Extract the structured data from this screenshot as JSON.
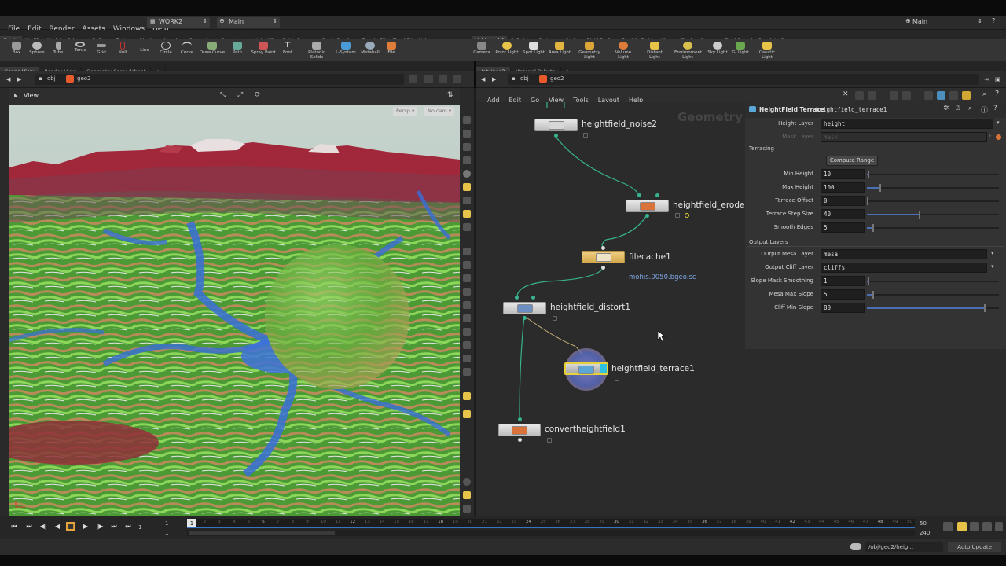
{
  "menubar": {
    "items": [
      "File",
      "Edit",
      "Render",
      "Assets",
      "Windows",
      "Help"
    ],
    "desktop": "WORK2",
    "context": "Main",
    "right_context": "Main"
  },
  "shelf_left": {
    "tabs": [
      "Create",
      "Modify",
      "Model",
      "Polygon",
      "Deform",
      "Texture",
      "Rigging",
      "Muscles",
      "Characters",
      "Constraints",
      "Hair Utils",
      "Guide Process",
      "Guide Brushes",
      "Terrain FX",
      "Cloud FX",
      "Volume"
    ],
    "tools": [
      "Box",
      "Sphere",
      "Tube",
      "Torus",
      "Grid",
      "Null",
      "Line",
      "Circle",
      "Curve",
      "Draw Curve",
      "Path",
      "Spray Paint",
      "Font",
      "Platonic Solids",
      "L-System",
      "Metaball",
      "File"
    ]
  },
  "shelf_right": {
    "tabs": [
      "Lights and C",
      "Collisions",
      "Particles",
      "Grains",
      "Rigid Bodies",
      "Particle Fluids",
      "Viscous Fluids",
      "Oceans",
      "Fluid Contai",
      "Populate C"
    ],
    "tools": [
      "Camera",
      "Point Light",
      "Spot Light",
      "Area Light",
      "Geometry Light",
      "Volume Light",
      "Distant Light",
      "Environment Light",
      "Sky Light",
      "GI Light",
      "Caustic Light"
    ]
  },
  "left_pane": {
    "tabs": [
      "Scene View",
      "Render View",
      "Geometry Spreadsheet"
    ],
    "path": [
      "obj",
      "geo2"
    ],
    "view_label": "View",
    "persp": "Persp ▾",
    "cam": "No cam ▾"
  },
  "right_pane": {
    "tabs": [
      "/obj/geo2",
      "Material Palette"
    ],
    "path": [
      "obj",
      "geo2"
    ],
    "menu": [
      "Add",
      "Edit",
      "Go",
      "View",
      "Tools",
      "Layout",
      "Help"
    ],
    "watermark": "Geometry"
  },
  "nodes": {
    "noise": "heightfield_noise2",
    "erode": "heightfield_erode1",
    "filecache": "filecache1",
    "filecache_path": "mohis.0050.bgeo.sc",
    "distort": "heightfield_distort1",
    "terrace": "heightfield_terrace1",
    "convert": "convertheightfield1"
  },
  "parms": {
    "node_type": "HeightField Terrace",
    "node_name": "heightfield_terrace1",
    "height_layer_label": "Height Layer",
    "height_layer": "height",
    "mask_layer_label": "Mask Layer",
    "mask_layer": "mask",
    "terracing_header": "Terracing",
    "compute_range": "Compute Range",
    "min_height_label": "Min Height",
    "min_height": "10",
    "max_height_label": "Max Height",
    "max_height": "100",
    "terrace_offset_label": "Terrace Offset",
    "terrace_offset": "0",
    "step_size_label": "Terrace Step Size",
    "step_size": "40",
    "smooth_label": "Smooth Edges",
    "smooth": "5",
    "output_header": "Output Layers",
    "mesa_layer_label": "Output Mesa Layer",
    "mesa_layer": "mesa",
    "cliff_layer_label": "Output Cliff Layer",
    "cliff_layer": "cliffs",
    "slope_smooth_label": "Slope Mask Smoothing",
    "slope_smooth": "1",
    "mesa_slope_label": "Mesa Max Slope",
    "mesa_slope": "5",
    "cliff_slope_label": "Cliff Min Slope",
    "cliff_slope": "80",
    "slider_levels": {
      "min_height": 0.01,
      "max_height": 0.1,
      "terrace_offset": 0.0,
      "step_size": 0.4,
      "smooth": 0.05,
      "slope_smooth": 0.01,
      "mesa_slope": 0.05,
      "cliff_slope": 0.89
    }
  },
  "timeline": {
    "start": "1",
    "start2": "1",
    "current": "1",
    "end": "50",
    "end2": "240",
    "ticks": [
      "1",
      "2",
      "3",
      "4",
      "5",
      "6",
      "7",
      "8",
      "9",
      "10",
      "11",
      "12",
      "13",
      "14",
      "15",
      "16",
      "17",
      "18",
      "19",
      "20",
      "21",
      "22",
      "23",
      "24",
      "25",
      "26",
      "27",
      "28",
      "29",
      "30",
      "31",
      "32",
      "33",
      "34",
      "35",
      "36",
      "37",
      "38",
      "39",
      "40",
      "41",
      "42",
      "43",
      "44",
      "45",
      "46",
      "47",
      "48",
      "49",
      "50"
    ]
  },
  "status": {
    "path": "/obj/geo2/heig...",
    "update": "Auto Update"
  }
}
